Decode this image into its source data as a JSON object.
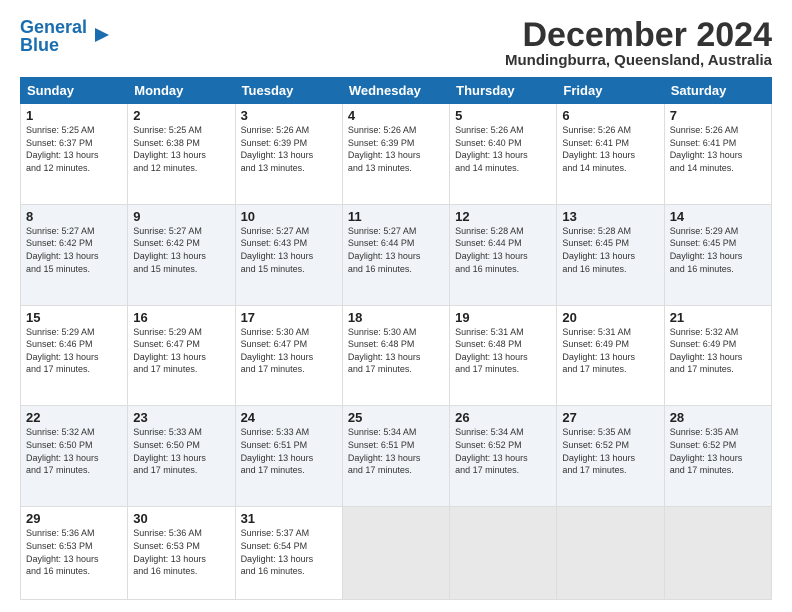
{
  "logo": {
    "line1": "General",
    "line2": "Blue"
  },
  "title": "December 2024",
  "location": "Mundingburra, Queensland, Australia",
  "days_header": [
    "Sunday",
    "Monday",
    "Tuesday",
    "Wednesday",
    "Thursday",
    "Friday",
    "Saturday"
  ],
  "weeks": [
    [
      {
        "day": "1",
        "info": "Sunrise: 5:25 AM\nSunset: 6:37 PM\nDaylight: 13 hours\nand 12 minutes."
      },
      {
        "day": "2",
        "info": "Sunrise: 5:25 AM\nSunset: 6:38 PM\nDaylight: 13 hours\nand 12 minutes."
      },
      {
        "day": "3",
        "info": "Sunrise: 5:26 AM\nSunset: 6:39 PM\nDaylight: 13 hours\nand 13 minutes."
      },
      {
        "day": "4",
        "info": "Sunrise: 5:26 AM\nSunset: 6:39 PM\nDaylight: 13 hours\nand 13 minutes."
      },
      {
        "day": "5",
        "info": "Sunrise: 5:26 AM\nSunset: 6:40 PM\nDaylight: 13 hours\nand 14 minutes."
      },
      {
        "day": "6",
        "info": "Sunrise: 5:26 AM\nSunset: 6:41 PM\nDaylight: 13 hours\nand 14 minutes."
      },
      {
        "day": "7",
        "info": "Sunrise: 5:26 AM\nSunset: 6:41 PM\nDaylight: 13 hours\nand 14 minutes."
      }
    ],
    [
      {
        "day": "8",
        "info": "Sunrise: 5:27 AM\nSunset: 6:42 PM\nDaylight: 13 hours\nand 15 minutes."
      },
      {
        "day": "9",
        "info": "Sunrise: 5:27 AM\nSunset: 6:42 PM\nDaylight: 13 hours\nand 15 minutes."
      },
      {
        "day": "10",
        "info": "Sunrise: 5:27 AM\nSunset: 6:43 PM\nDaylight: 13 hours\nand 15 minutes."
      },
      {
        "day": "11",
        "info": "Sunrise: 5:27 AM\nSunset: 6:44 PM\nDaylight: 13 hours\nand 16 minutes."
      },
      {
        "day": "12",
        "info": "Sunrise: 5:28 AM\nSunset: 6:44 PM\nDaylight: 13 hours\nand 16 minutes."
      },
      {
        "day": "13",
        "info": "Sunrise: 5:28 AM\nSunset: 6:45 PM\nDaylight: 13 hours\nand 16 minutes."
      },
      {
        "day": "14",
        "info": "Sunrise: 5:29 AM\nSunset: 6:45 PM\nDaylight: 13 hours\nand 16 minutes."
      }
    ],
    [
      {
        "day": "15",
        "info": "Sunrise: 5:29 AM\nSunset: 6:46 PM\nDaylight: 13 hours\nand 17 minutes."
      },
      {
        "day": "16",
        "info": "Sunrise: 5:29 AM\nSunset: 6:47 PM\nDaylight: 13 hours\nand 17 minutes."
      },
      {
        "day": "17",
        "info": "Sunrise: 5:30 AM\nSunset: 6:47 PM\nDaylight: 13 hours\nand 17 minutes."
      },
      {
        "day": "18",
        "info": "Sunrise: 5:30 AM\nSunset: 6:48 PM\nDaylight: 13 hours\nand 17 minutes."
      },
      {
        "day": "19",
        "info": "Sunrise: 5:31 AM\nSunset: 6:48 PM\nDaylight: 13 hours\nand 17 minutes."
      },
      {
        "day": "20",
        "info": "Sunrise: 5:31 AM\nSunset: 6:49 PM\nDaylight: 13 hours\nand 17 minutes."
      },
      {
        "day": "21",
        "info": "Sunrise: 5:32 AM\nSunset: 6:49 PM\nDaylight: 13 hours\nand 17 minutes."
      }
    ],
    [
      {
        "day": "22",
        "info": "Sunrise: 5:32 AM\nSunset: 6:50 PM\nDaylight: 13 hours\nand 17 minutes."
      },
      {
        "day": "23",
        "info": "Sunrise: 5:33 AM\nSunset: 6:50 PM\nDaylight: 13 hours\nand 17 minutes."
      },
      {
        "day": "24",
        "info": "Sunrise: 5:33 AM\nSunset: 6:51 PM\nDaylight: 13 hours\nand 17 minutes."
      },
      {
        "day": "25",
        "info": "Sunrise: 5:34 AM\nSunset: 6:51 PM\nDaylight: 13 hours\nand 17 minutes."
      },
      {
        "day": "26",
        "info": "Sunrise: 5:34 AM\nSunset: 6:52 PM\nDaylight: 13 hours\nand 17 minutes."
      },
      {
        "day": "27",
        "info": "Sunrise: 5:35 AM\nSunset: 6:52 PM\nDaylight: 13 hours\nand 17 minutes."
      },
      {
        "day": "28",
        "info": "Sunrise: 5:35 AM\nSunset: 6:52 PM\nDaylight: 13 hours\nand 17 minutes."
      }
    ],
    [
      {
        "day": "29",
        "info": "Sunrise: 5:36 AM\nSunset: 6:53 PM\nDaylight: 13 hours\nand 16 minutes."
      },
      {
        "day": "30",
        "info": "Sunrise: 5:36 AM\nSunset: 6:53 PM\nDaylight: 13 hours\nand 16 minutes."
      },
      {
        "day": "31",
        "info": "Sunrise: 5:37 AM\nSunset: 6:54 PM\nDaylight: 13 hours\nand 16 minutes."
      },
      {
        "day": "",
        "info": ""
      },
      {
        "day": "",
        "info": ""
      },
      {
        "day": "",
        "info": ""
      },
      {
        "day": "",
        "info": ""
      }
    ]
  ]
}
